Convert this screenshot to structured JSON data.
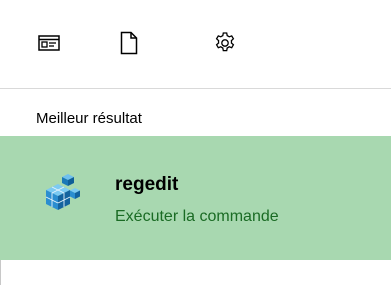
{
  "toolbar": {
    "buttons": [
      {
        "icon": "apps-icon"
      },
      {
        "icon": "document-icon"
      },
      {
        "icon": "gear-icon"
      }
    ]
  },
  "best_match": {
    "heading": "Meilleur résultat",
    "result": {
      "name": "regedit",
      "subtitle": "Exécuter la commande",
      "icon": "registry-editor-icon"
    }
  },
  "colors": {
    "selected_background": "#a8d8b0",
    "subtitle_text": "#1a6b24",
    "icon_blue": "#1f86c8"
  }
}
